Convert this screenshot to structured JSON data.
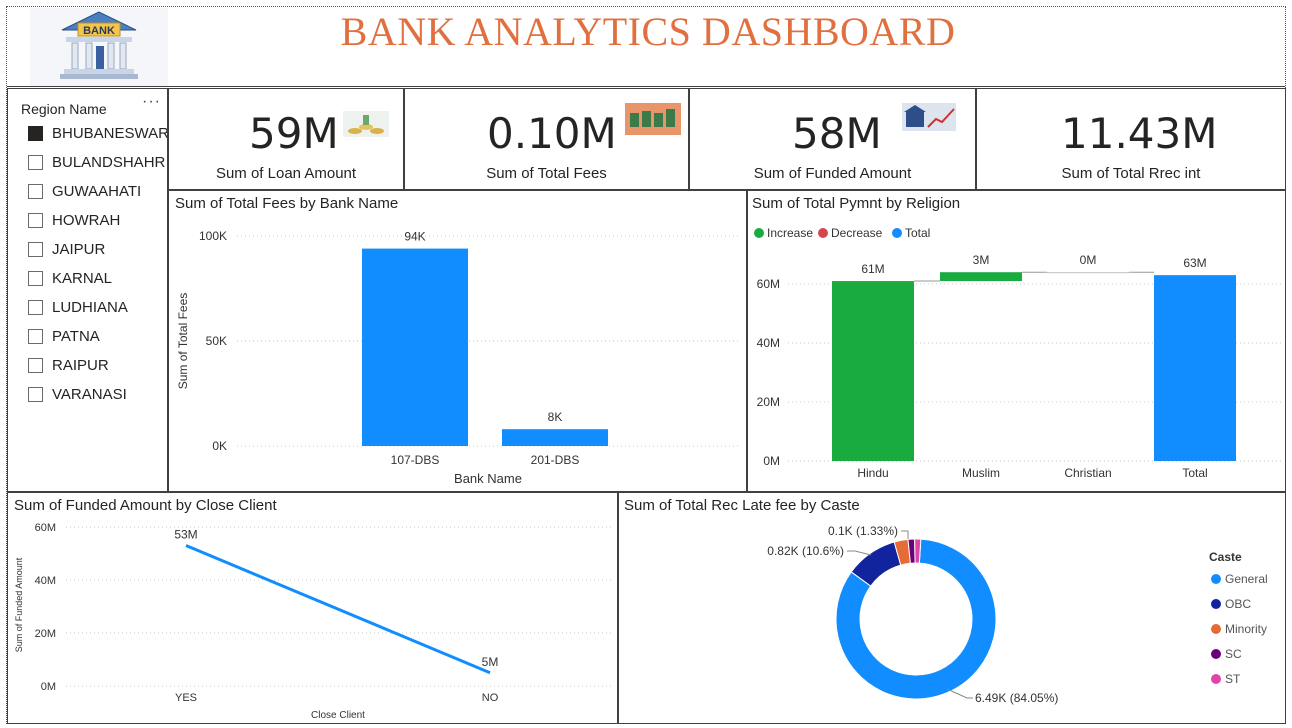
{
  "header": {
    "title": "BANK ANALYTICS DASHBOARD",
    "logo_text": "BANK"
  },
  "slicer": {
    "title": "Region Name",
    "more_icon": "more-options-icon",
    "items": [
      {
        "label": "BHUBANESWAR",
        "checked": true
      },
      {
        "label": "BULANDSHAHR",
        "checked": false
      },
      {
        "label": "GUWAAHATI",
        "checked": false
      },
      {
        "label": "HOWRAH",
        "checked": false
      },
      {
        "label": "JAIPUR",
        "checked": false
      },
      {
        "label": "KARNAL",
        "checked": false
      },
      {
        "label": "LUDHIANA",
        "checked": false
      },
      {
        "label": "PATNA",
        "checked": false
      },
      {
        "label": "RAIPUR",
        "checked": false
      },
      {
        "label": "VARANASI",
        "checked": false
      }
    ]
  },
  "kpis": [
    {
      "value": "59M",
      "label": "Sum of Loan Amount",
      "icon": "coins-icon"
    },
    {
      "value": "0.10M",
      "label": "Sum of Total Fees",
      "icon": "fees-icon"
    },
    {
      "value": "58M",
      "label": "Sum of Funded Amount",
      "icon": "bank-growth-icon"
    },
    {
      "value": "11.43M",
      "label": "Sum of Total Rrec int",
      "icon": ""
    }
  ],
  "colors": {
    "blue": "#118dff",
    "green": "#1aab40",
    "red": "#d64550",
    "navy": "#12239e",
    "orange": "#e66c37",
    "purple": "#6b007b",
    "pink": "#e044a7",
    "title": "#e07040"
  },
  "chart_data": [
    {
      "type": "bar",
      "title": "Sum of Total Fees by Bank Name",
      "xlabel": "Bank Name",
      "ylabel": "Sum of Total Fees",
      "categories": [
        "107-DBS",
        "201-DBS"
      ],
      "values": [
        94000,
        8000
      ],
      "data_labels": [
        "94K",
        "8K"
      ],
      "ylim": [
        0,
        100000
      ],
      "yticks": [
        "0K",
        "50K",
        "100K"
      ]
    },
    {
      "type": "bar",
      "subtype": "waterfall",
      "title": "Sum of Total Pymnt by Religion",
      "legend": [
        "Increase",
        "Decrease",
        "Total"
      ],
      "categories": [
        "Hindu",
        "Muslim",
        "Christian",
        "Total"
      ],
      "values": [
        61,
        3,
        0,
        63
      ],
      "kinds": [
        "increase",
        "increase",
        "increase",
        "total"
      ],
      "data_labels": [
        "61M",
        "3M",
        "0M",
        "63M"
      ],
      "ylim": [
        0,
        70
      ],
      "yticks": [
        "0M",
        "20M",
        "40M",
        "60M"
      ]
    },
    {
      "type": "line",
      "title": "Sum of Funded Amount by Close Client",
      "xlabel": "Close Client",
      "ylabel": "Sum of Funded Amount",
      "categories": [
        "YES",
        "NO"
      ],
      "values": [
        53,
        5
      ],
      "data_labels": [
        "53M",
        "5M"
      ],
      "ylim": [
        0,
        60
      ],
      "yticks": [
        "0M",
        "20M",
        "40M",
        "60M"
      ]
    },
    {
      "type": "pie",
      "subtype": "donut",
      "title": "Sum of Total Rec Late fee by Caste",
      "legend_title": "Caste",
      "categories": [
        "General",
        "OBC",
        "Minority",
        "SC",
        "ST"
      ],
      "values": [
        84.05,
        10.6,
        2.8,
        1.33,
        1.22
      ],
      "data_labels": [
        "6.49K (84.05%)",
        "0.82K (10.6%)",
        "",
        "0.1K (1.33%)",
        ""
      ]
    }
  ]
}
